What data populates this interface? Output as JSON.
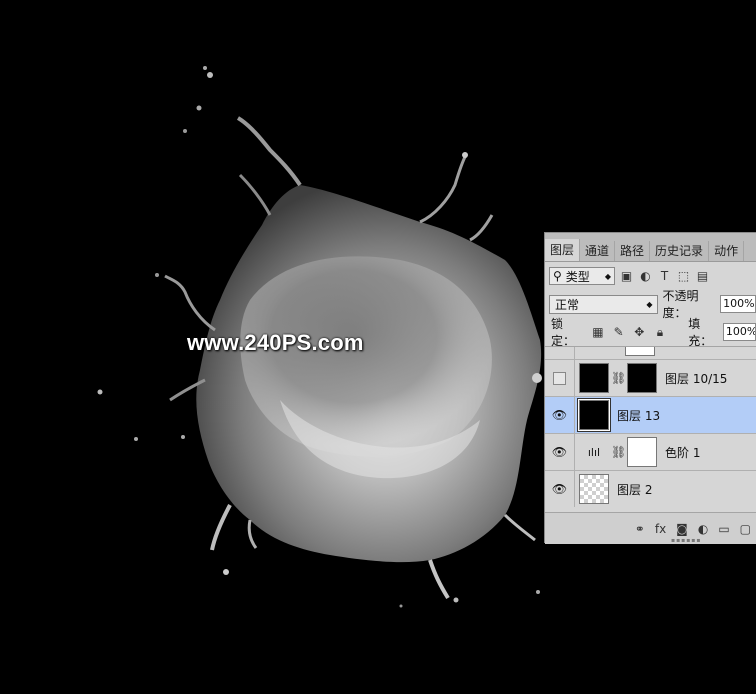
{
  "watermark": "www.240PS.com",
  "layers_panel": {
    "tabs": [
      "图层",
      "通道",
      "路径",
      "历史记录",
      "动作"
    ],
    "active_tab": "图层",
    "kind_filter": {
      "icon": "search-icon",
      "value": "类型"
    },
    "filter_icons": [
      "image-filter-icon",
      "adjustment-filter-icon",
      "text-filter-icon",
      "shape-filter-icon",
      "smart-object-filter-icon"
    ],
    "blend_mode": "正常",
    "opacity_label": "不透明度：",
    "opacity_value": "100%",
    "lock_label": "锁定：",
    "lock_icons": [
      "lock-transparency-icon",
      "lock-paint-icon",
      "lock-position-icon",
      "lock-all-icon"
    ],
    "fill_label": "填充：",
    "fill_value": "100%",
    "layers": [
      {
        "name": "图层 10/15",
        "visible": false,
        "thumb": "black-splash",
        "mask": "white-splash",
        "selected": false
      },
      {
        "name": "图层 13",
        "visible": true,
        "thumb": "black-splash",
        "selected": true
      },
      {
        "name": "色阶 1",
        "visible": true,
        "thumb": "levels-adjustment-icon",
        "mask": "white",
        "selected": false
      },
      {
        "name": "图层 2",
        "visible": true,
        "thumb": "transparent",
        "selected": false
      }
    ],
    "bottom_icons": [
      "link-layers-icon",
      "fx-icon",
      "add-mask-icon",
      "adjustment-layer-icon",
      "new-group-icon",
      "new-layer-icon"
    ]
  }
}
